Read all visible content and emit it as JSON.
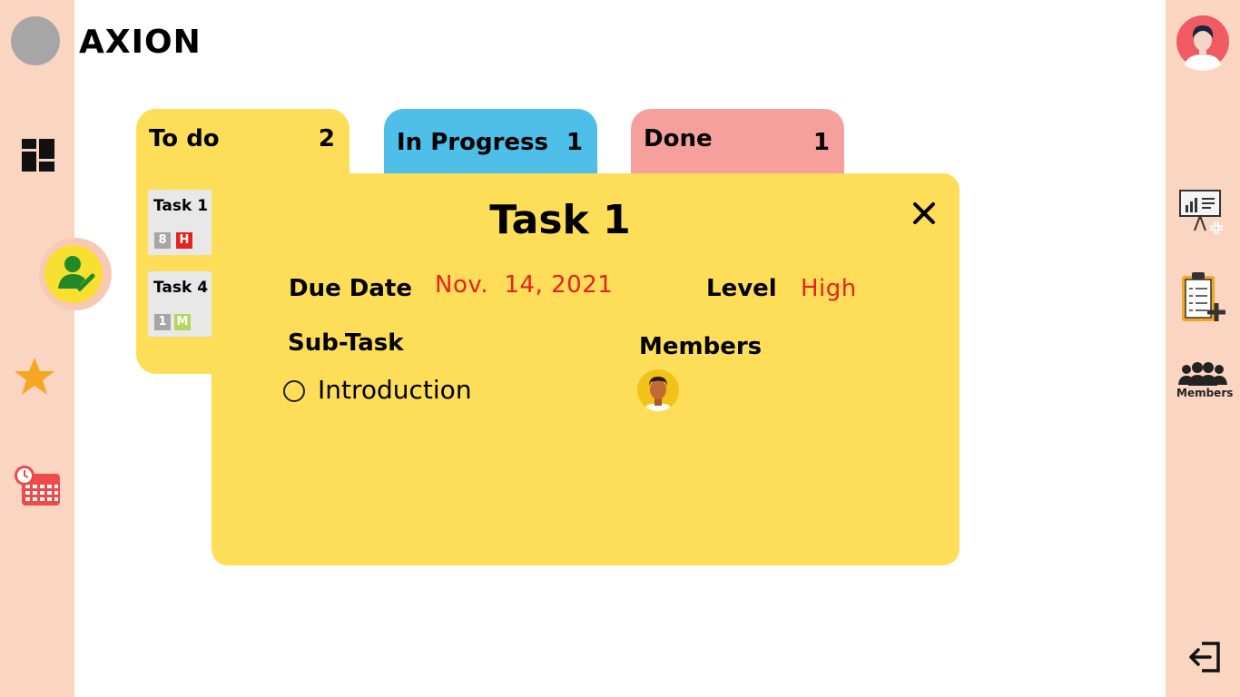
{
  "app": {
    "brand": "AXION"
  },
  "sidebar": {
    "items": [
      {
        "icon": "dashboard-icon"
      },
      {
        "icon": "assigned-user-icon",
        "active": true
      },
      {
        "icon": "star-icon"
      },
      {
        "icon": "calendar-clock-icon"
      }
    ]
  },
  "columns": [
    {
      "title": "To do",
      "count": "2",
      "color": "#fedd58"
    },
    {
      "title": "In Progress",
      "count": "1",
      "color": "#4ebfe8"
    },
    {
      "title": "Done",
      "count": "1",
      "color": "#f5a09c"
    }
  ],
  "todo_tasks": [
    {
      "name": "Task 1",
      "badges": [
        {
          "text": "8",
          "color": "#a6a6a6"
        },
        {
          "text": "H",
          "color": "#e8221f"
        }
      ]
    },
    {
      "name": "Task 4",
      "badges": [
        {
          "text": "1",
          "color": "#a6a6a6"
        },
        {
          "text": "M",
          "color": "#b5d55b"
        }
      ]
    }
  ],
  "modal": {
    "title": "Task 1",
    "due_date_label": "Due Date",
    "due_date_value": "Nov.  14, 2021",
    "level_label": "Level",
    "level_value": "High",
    "subtask_label": "Sub-Task",
    "subtasks": [
      "Introduction"
    ],
    "members_label": "Members",
    "members": [
      "member-avatar"
    ]
  },
  "right_panel": {
    "items": [
      {
        "icon": "add-presentation-icon"
      },
      {
        "icon": "add-task-clipboard-icon"
      },
      {
        "icon": "members-group-icon",
        "label": "Members"
      }
    ],
    "logout": "logout-icon"
  },
  "colors": {
    "rail": "#fad5c1",
    "modal": "#fedd58",
    "accent_red": "#e8221f"
  }
}
